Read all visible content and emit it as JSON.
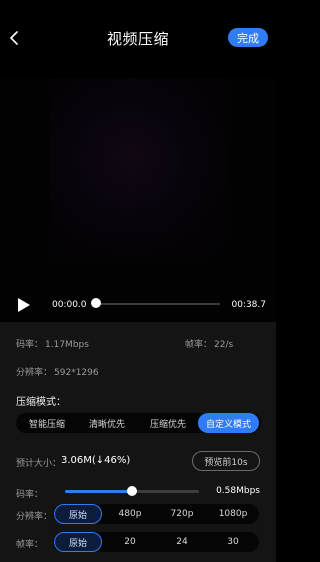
{
  "header": {
    "title": "视频压缩",
    "done_label": "完成"
  },
  "player": {
    "time_start": "00:00.0",
    "time_end": "00:38.7",
    "progress": 0
  },
  "info": {
    "bitrate_label": "码率：",
    "bitrate_value": "1.17Mbps",
    "fps_label": "帧率：",
    "fps_value": "22/s",
    "resolution_label": "分辨率：",
    "resolution_value": "592*1296"
  },
  "compression": {
    "title": "压缩模式：",
    "modes": [
      "智能压缩",
      "清晰优先",
      "压缩优先",
      "自定义模式"
    ],
    "selected_index": 3
  },
  "estimate": {
    "label": "预计大小：",
    "value": "3.06M(↓46%)",
    "preview_label": "预览前10s"
  },
  "custom": {
    "bitrate_label": "码率：",
    "bitrate_value": "0.58Mbps",
    "bitrate_fraction": 0.5,
    "resolution_label": "分辨率：",
    "resolution_options": [
      "原始",
      "480p",
      "720p",
      "1080p"
    ],
    "resolution_selected": 0,
    "fps_label": "帧率：",
    "fps_options": [
      "原始",
      "20",
      "24",
      "30"
    ],
    "fps_selected": 0
  },
  "colors": {
    "accent": "#2F7CF6",
    "background": "#000000",
    "panel": "#141414"
  }
}
